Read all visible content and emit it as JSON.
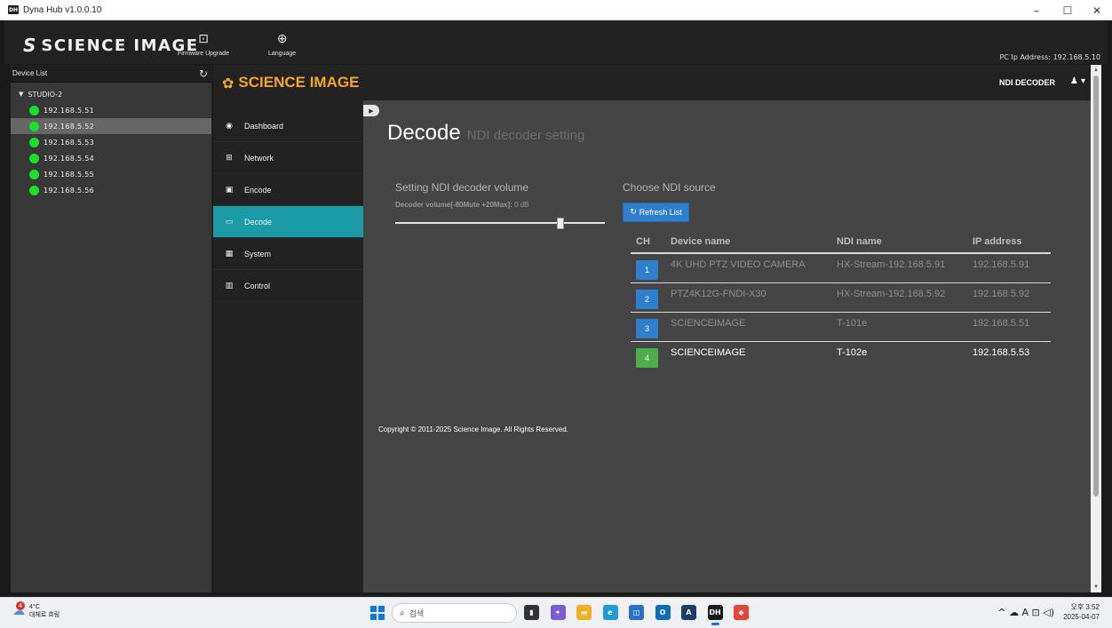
{
  "window": {
    "title": "Dyna Hub v1.0.0.10",
    "app_icon": "DH",
    "minimize": "–",
    "maximize": "☐",
    "close": "✕"
  },
  "app_header": {
    "brand": "SCIENCE IMAGE",
    "brand_mark": "S",
    "tools": [
      {
        "label": "Firmware Upgrade",
        "icon": "chip-icon",
        "glyph": "⊡"
      },
      {
        "label": "Language",
        "icon": "globe-icon",
        "glyph": "⊕"
      }
    ],
    "pc_ip_label": "PC Ip Address:",
    "pc_ip_value": "192.168.5.10"
  },
  "device_list": {
    "title": "Device List",
    "refresh_glyph": "↻",
    "group": "STUDIO-2",
    "items": [
      {
        "ip": "192.168.5.51",
        "status": "online"
      },
      {
        "ip": "192.168.5.52",
        "status": "online"
      },
      {
        "ip": "192.168.5.53",
        "status": "online"
      },
      {
        "ip": "192.168.5.54",
        "status": "online"
      },
      {
        "ip": "192.168.5.55",
        "status": "online"
      },
      {
        "ip": "192.168.5.56",
        "status": "online"
      }
    ],
    "selected_ip": "192.168.5.52"
  },
  "web": {
    "logo": "SCIENCE IMAGE",
    "logo_icon": "gear-icon",
    "device_type": "NDI DECODER",
    "user_glyph": "♟ ▾",
    "nav": [
      {
        "label": "Dashboard",
        "icon": "dashboard-icon",
        "glyph": "◉"
      },
      {
        "label": "Network",
        "icon": "network-icon",
        "glyph": "⊞"
      },
      {
        "label": "Encode",
        "icon": "encode-icon",
        "glyph": "▣"
      },
      {
        "label": "Decode",
        "icon": "monitor-icon",
        "glyph": "▭"
      },
      {
        "label": "System",
        "icon": "system-icon",
        "glyph": "▦"
      },
      {
        "label": "Control",
        "icon": "control-icon",
        "glyph": "▥"
      }
    ],
    "active_nav": "Decode",
    "collapse_glyph": "▶",
    "page_title": "Decode",
    "page_subtitle": "NDI decoder setting",
    "volume": {
      "title": "Setting NDI decoder volume",
      "label": "Decoder volume[-80Mute +20Max]:",
      "value_text": "0 dB",
      "min": -80,
      "max": 20,
      "value": 0
    },
    "source": {
      "title": "Choose NDI source",
      "refresh_glyph": "↻",
      "refresh_label": "Refresh List",
      "columns": [
        "CH",
        "Device name",
        "NDI name",
        "IP address"
      ],
      "rows": [
        {
          "ch": "1",
          "device": "4K UHD PTZ VIDEO CAMERA",
          "ndi": "HX-Stream-192.168.5.91",
          "ip": "192.168.5.91",
          "selected": false
        },
        {
          "ch": "2",
          "device": "PTZ4K12G-FNDI-X30",
          "ndi": "HX-Stream-192.168.5.92",
          "ip": "192.168.5.92",
          "selected": false
        },
        {
          "ch": "3",
          "device": "SCIENCEIMAGE",
          "ndi": "T-101e",
          "ip": "192.168.5.51",
          "selected": false
        },
        {
          "ch": "4",
          "device": "SCIENCEIMAGE",
          "ndi": "T-102e",
          "ip": "192.168.5.53",
          "selected": true
        }
      ]
    },
    "copyright": "Copyright © 2011-2025 Science Image. All Rights Reserved."
  },
  "taskbar": {
    "weather_temp": "4°C",
    "weather_desc": "대체로 흐림",
    "weather_badge": "4",
    "search_placeholder": "검색",
    "search_glyph": "🔍",
    "apps": [
      {
        "name": "file-explorer-icon",
        "glyph": "▮",
        "color": "#333333"
      },
      {
        "name": "copilot-icon",
        "glyph": "✦",
        "color": "#7a5cd6"
      },
      {
        "name": "folder-icon",
        "glyph": "▬",
        "color": "#f2b01e"
      },
      {
        "name": "edge-icon",
        "glyph": "e",
        "color": "#1f9bd7"
      },
      {
        "name": "store-icon",
        "glyph": "◫",
        "color": "#2b6fc9"
      },
      {
        "name": "outlook-icon",
        "glyph": "O",
        "color": "#0f6cbd"
      },
      {
        "name": "app-a-icon",
        "glyph": "A",
        "color": "#1d3e66"
      },
      {
        "name": "dynahub-icon",
        "glyph": "DH",
        "color": "#1a1a1a"
      },
      {
        "name": "remote-icon",
        "glyph": "◆",
        "color": "#e6443a"
      }
    ],
    "tray_glyphs": "^ ☁ A ⊡ ◁)",
    "time": "오후 3:52",
    "date": "2025-04-07"
  }
}
